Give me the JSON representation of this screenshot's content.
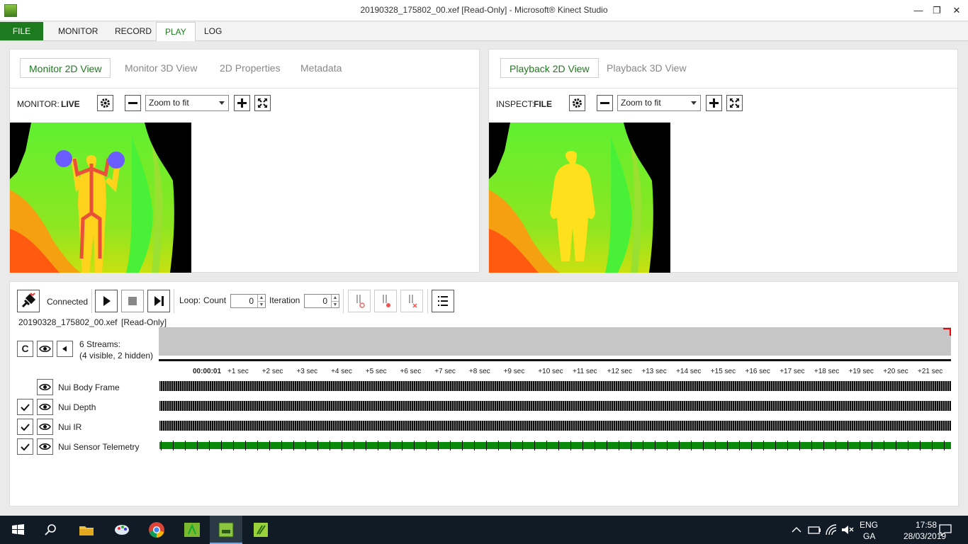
{
  "window": {
    "title": "20190328_175802_00.xef [Read-Only] - Microsoft® Kinect Studio",
    "minimize": "—",
    "maximize": "❐",
    "close": "✕"
  },
  "menu": {
    "file": "FILE",
    "monitor": "MONITOR",
    "record": "RECORD",
    "play": "PLAY",
    "log": "LOG"
  },
  "left_panel": {
    "tabs": [
      "Monitor 2D View",
      "Monitor 3D View",
      "2D Properties",
      "Metadata"
    ],
    "label": "MONITOR:",
    "mode": "LIVE",
    "zoom": "Zoom to fit"
  },
  "right_panel": {
    "tabs": [
      "Playback 2D View",
      "Playback 3D View"
    ],
    "label": "INSPECT:",
    "mode": "FILE",
    "zoom": "Zoom to fit"
  },
  "transport": {
    "status": "Connected",
    "loop_label": "Loop:",
    "count_label": "Count",
    "count_value": "0",
    "iteration_label": "Iteration",
    "iteration_value": "0",
    "file_name": "20190328_175802_00.xef",
    "file_mode": "[Read-Only]"
  },
  "streams": {
    "summary_line1": "6 Streams:",
    "summary_line2": "(4 visible, 2 hidden)",
    "c_button": "C",
    "items": [
      {
        "name": "Nui Body Frame",
        "checked": false
      },
      {
        "name": "Nui Depth",
        "checked": true
      },
      {
        "name": "Nui IR",
        "checked": true
      },
      {
        "name": "Nui Sensor Telemetry",
        "checked": true
      }
    ]
  },
  "timeline": {
    "start": "00:00:01",
    "ticks": [
      "+1 sec",
      "+2 sec",
      "+3 sec",
      "+4 sec",
      "+5 sec",
      "+6 sec",
      "+7 sec",
      "+8 sec",
      "+9 sec",
      "+10 sec",
      "+11 sec",
      "+12 sec",
      "+13 sec",
      "+14 sec",
      "+15 sec",
      "+16 sec",
      "+17 sec",
      "+18 sec",
      "+19 sec",
      "+20 sec",
      "+21 sec"
    ]
  },
  "tray": {
    "lang": "ENG",
    "region": "GA",
    "time": "17:58",
    "date": "28/03/2019"
  },
  "colors": {
    "accent": "#1e7a1e",
    "track_fill": "#0a8a0a"
  }
}
